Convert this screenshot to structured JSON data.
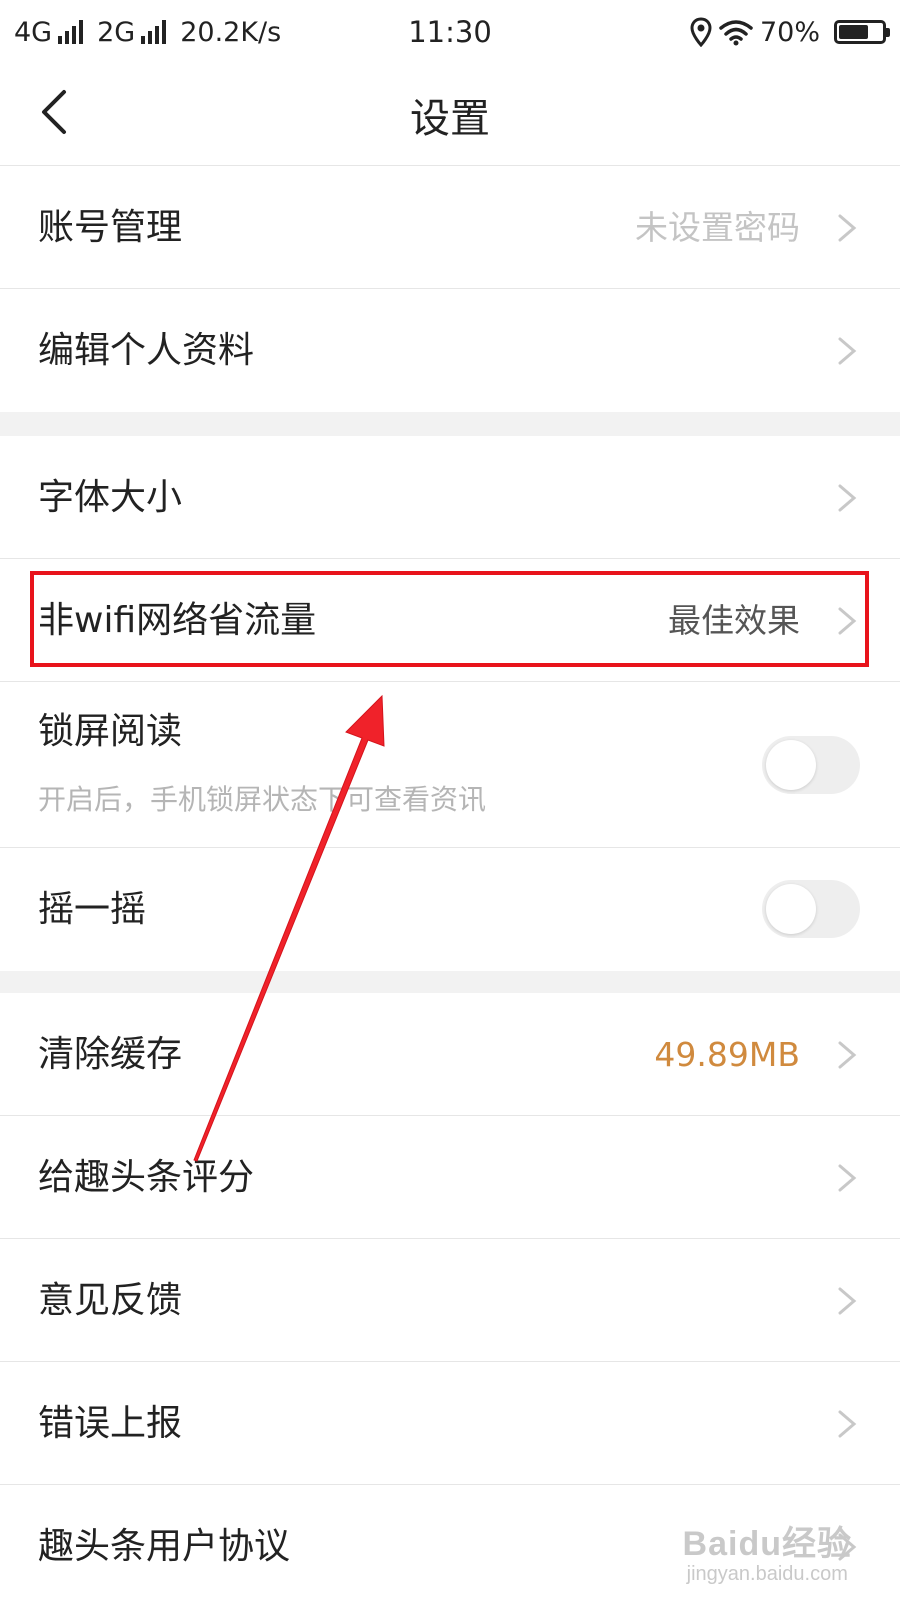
{
  "status_bar": {
    "net1": "4G",
    "net2": "2G",
    "speed": "20.2K/s",
    "time": "11:30",
    "battery": "70%",
    "battery_level": 0.7
  },
  "header": {
    "title": "设置",
    "back_icon": "chevron-left-icon"
  },
  "settings": {
    "account": {
      "label": "账号管理",
      "value": "未设置密码"
    },
    "edit_profile": {
      "label": "编辑个人资料"
    },
    "font_size": {
      "label": "字体大小"
    },
    "data_saver": {
      "label": "非wifi网络省流量",
      "value": "最佳效果"
    },
    "lockscreen": {
      "label": "锁屏阅读",
      "description": "开启后，手机锁屏状态下可查看资讯",
      "enabled": false
    },
    "shake": {
      "label": "摇一摇",
      "enabled": false
    },
    "clear_cache": {
      "label": "清除缓存",
      "value": "49.89MB"
    },
    "rate": {
      "label": "给趣头条评分"
    },
    "feedback": {
      "label": "意见反馈"
    },
    "error_report": {
      "label": "错误上报"
    },
    "user_agreement": {
      "label": "趣头条用户协议"
    }
  },
  "colors": {
    "highlight": "#e8131b",
    "cache_value": "#d08a3e"
  },
  "watermark": {
    "logo": "Baidu经验",
    "url": "jingyan.baidu.com"
  }
}
